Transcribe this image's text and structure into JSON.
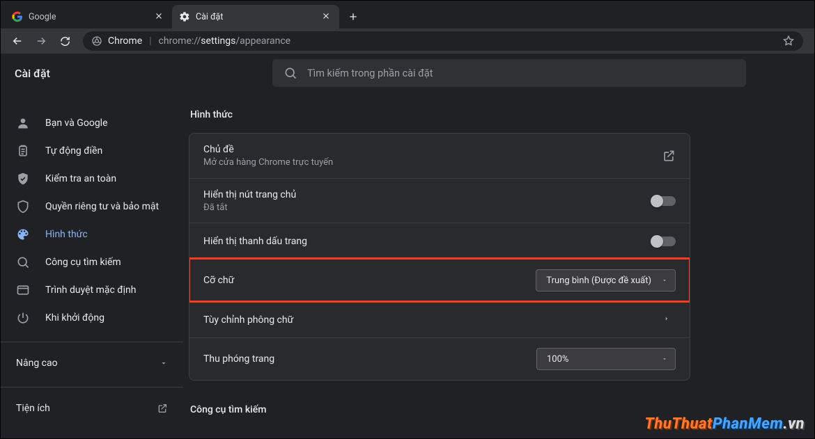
{
  "tabs": [
    {
      "title": "Google",
      "favicon": "google"
    },
    {
      "title": "Cài đặt",
      "favicon": "gear"
    }
  ],
  "active_tab_index": 1,
  "omnibox": {
    "scheme_label": "Chrome",
    "url_dim1": "chrome://",
    "url_lite": "settings",
    "url_dim2": "/appearance"
  },
  "settings": {
    "page_title": "Cài đặt",
    "search_placeholder": "Tìm kiếm trong phần cài đặt",
    "nav": [
      {
        "id": "you",
        "label": "Bạn và Google"
      },
      {
        "id": "autofill",
        "label": "Tự động điền"
      },
      {
        "id": "safety",
        "label": "Kiểm tra an toàn"
      },
      {
        "id": "privacy",
        "label": "Quyền riêng tư và bảo mật"
      },
      {
        "id": "appearance",
        "label": "Hình thức",
        "selected": true
      },
      {
        "id": "search",
        "label": "Công cụ tìm kiếm"
      },
      {
        "id": "defbrowser",
        "label": "Trình duyệt mặc định"
      },
      {
        "id": "startup",
        "label": "Khi khởi động"
      }
    ],
    "advanced_label": "Nâng cao",
    "extensions_label": "Tiện ích",
    "section_appearance_title": "Hình thức",
    "rows": {
      "theme": {
        "label": "Chủ đề",
        "sub": "Mở cửa hàng Chrome trực tuyến"
      },
      "homebutton": {
        "label": "Hiển thị nút trang chủ",
        "sub": "Đã tắt",
        "on": false
      },
      "bookmarksbar": {
        "label": "Hiển thị thanh dấu trang",
        "on": false
      },
      "fontsize": {
        "label": "Cỡ chữ",
        "value": "Trung bình (Được đề xuất)"
      },
      "customfonts": {
        "label": "Tùy chỉnh phông chữ"
      },
      "zoom": {
        "label": "Thu phóng trang",
        "value": "100%"
      }
    },
    "section_search_title": "Công cụ tìm kiếm"
  },
  "watermark": {
    "a": "ThuThuat",
    "b": "PhanMem",
    "c": ".vn"
  }
}
